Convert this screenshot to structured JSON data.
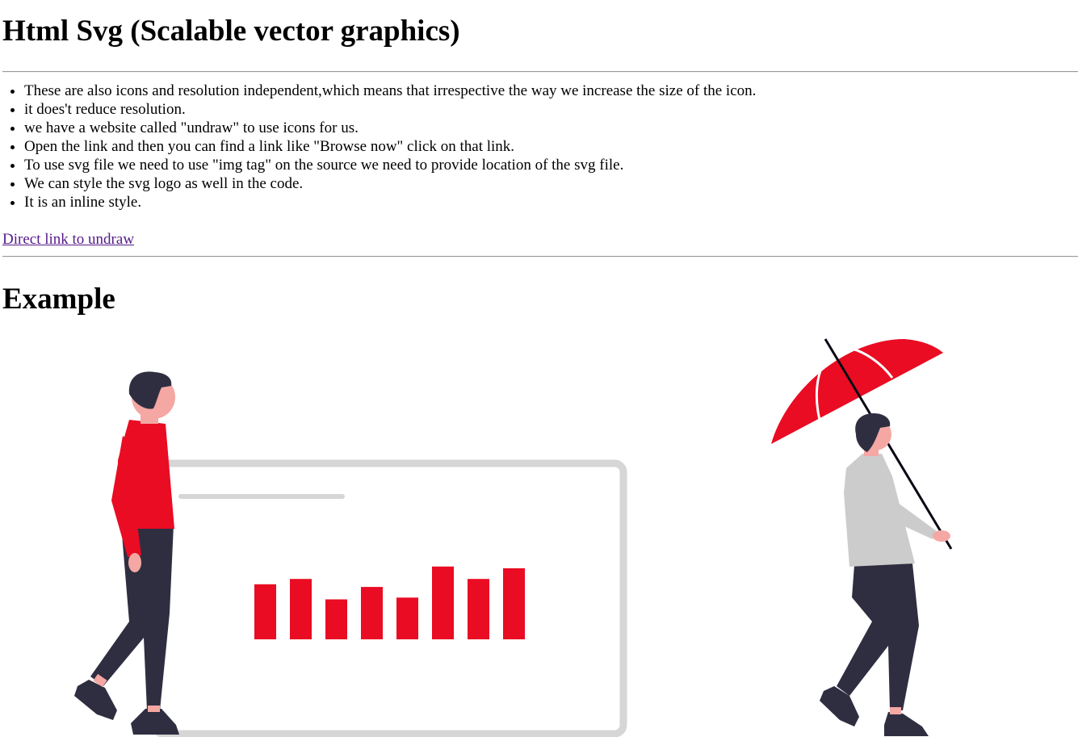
{
  "page": {
    "title": "Html Svg (Scalable vector graphics)",
    "bullets": [
      "These are also icons and resolution independent,which means that irrespective the way we increase the size of the icon.",
      "it does't reduce resolution.",
      "we have a website called \"undraw\" to use icons for us.",
      "Open the link and then you can find a link like \"Browse now\" click on that link.",
      "To use svg file we need to use \"img tag\" on the source we need to provide location of the svg file.",
      "We can style the svg logo as well in the code.",
      "It is an inline style."
    ],
    "link_text": "Direct link to undraw",
    "example_heading": "Example"
  },
  "illustration": {
    "accent_color": "#e90c23",
    "dark_color": "#2f2e41",
    "skin_color": "#f4a7a3",
    "frame_color": "#d6d6d6",
    "shirt_grey": "#cccccc",
    "bar_levels": [
      0.62,
      0.68,
      0.45,
      0.59,
      0.47,
      0.82,
      0.68,
      0.8
    ]
  }
}
